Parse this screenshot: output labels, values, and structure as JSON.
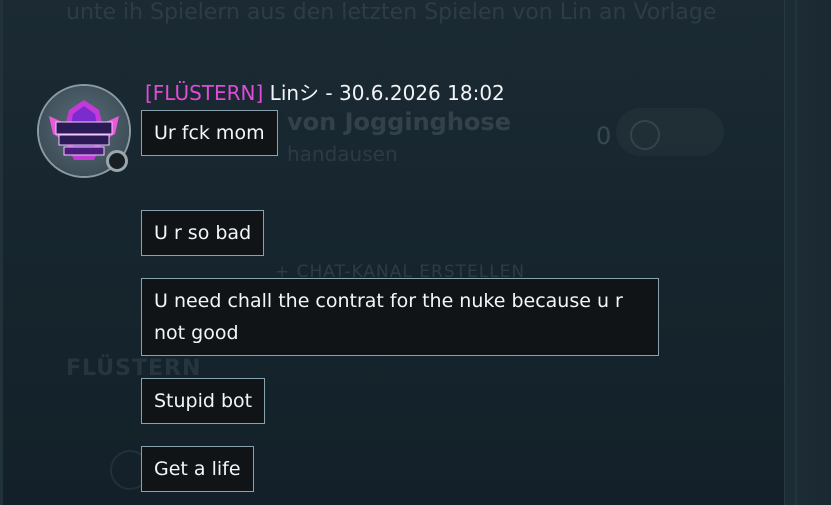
{
  "background": {
    "top_text": "unte ih Spielern aus den letzten Spielen von Lin an Vorlage",
    "title": "von Jogginghose",
    "subtitle": "handausen",
    "count": "0",
    "create_channel": "+ CHAT-KANAL ERSTELLEN",
    "section_label": "FLÜSTERN"
  },
  "whisper": {
    "tag": "[FLÜSTERN]",
    "sender": "Linシ",
    "separator": " - ",
    "timestamp": "30.6.2026 18:02",
    "tag_color": "#e04bd8",
    "avatar_badge": "RANKED PLAY WARZONE",
    "messages": [
      "Ur fck mom",
      "U r so bad",
      "U  need chall the contrat for the nuke because u r not good",
      "Stupid bot",
      "Get a life"
    ]
  }
}
